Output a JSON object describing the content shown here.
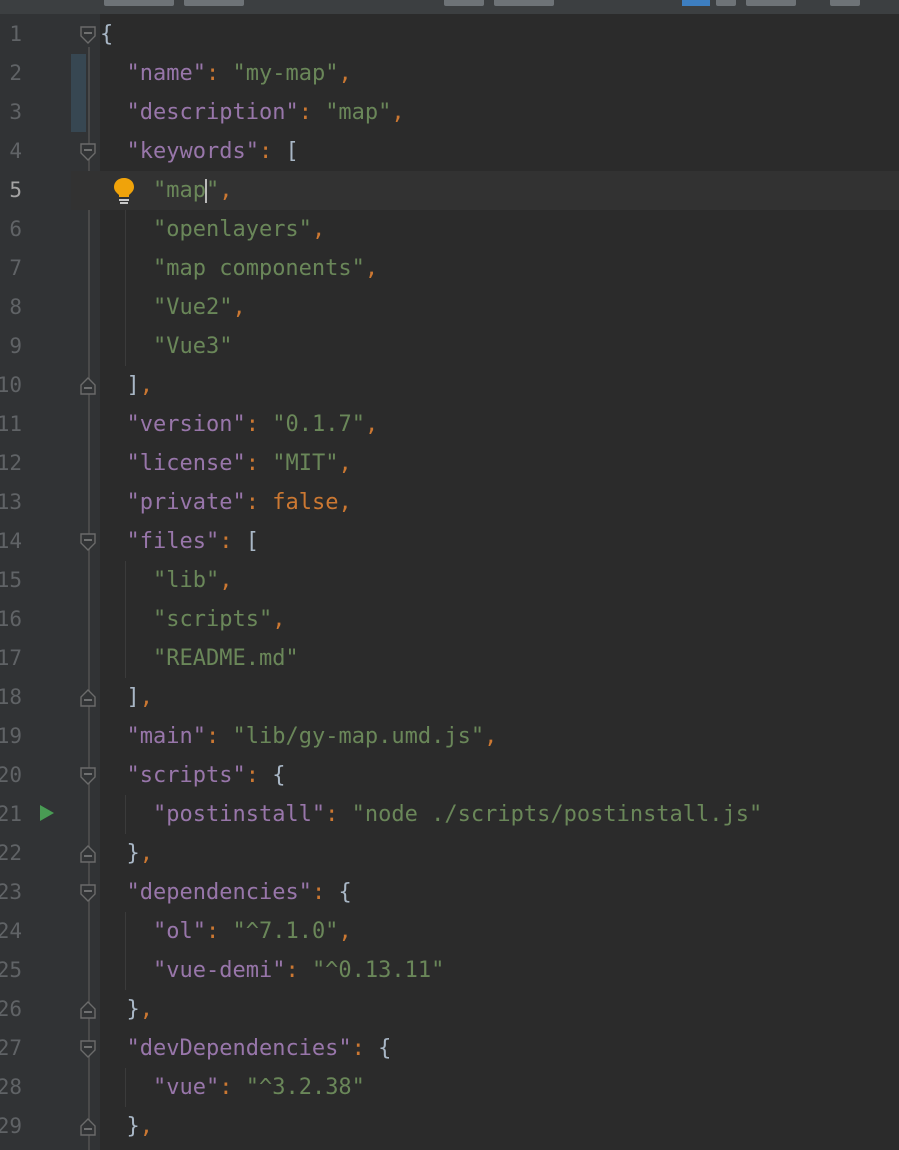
{
  "editor": {
    "file_type": "json",
    "current_line": 5,
    "lines": [
      {
        "num": "1"
      },
      {
        "num": "2"
      },
      {
        "num": "3"
      },
      {
        "num": "4"
      },
      {
        "num": "5"
      },
      {
        "num": "6"
      },
      {
        "num": "7"
      },
      {
        "num": "8"
      },
      {
        "num": "9"
      },
      {
        "num": "10"
      },
      {
        "num": "11"
      },
      {
        "num": "12"
      },
      {
        "num": "13"
      },
      {
        "num": "14"
      },
      {
        "num": "15"
      },
      {
        "num": "16"
      },
      {
        "num": "17"
      },
      {
        "num": "18"
      },
      {
        "num": "19"
      },
      {
        "num": "20"
      },
      {
        "num": "21"
      },
      {
        "num": "22"
      },
      {
        "num": "23"
      },
      {
        "num": "24"
      },
      {
        "num": "25"
      },
      {
        "num": "26"
      },
      {
        "num": "27"
      },
      {
        "num": "28"
      },
      {
        "num": "29"
      }
    ]
  },
  "code": {
    "l1": {
      "brace": "{"
    },
    "l2": {
      "key": "\"name\"",
      "colon": ":",
      "value": "\"my-map\"",
      "comma": ","
    },
    "l3": {
      "key": "\"description\"",
      "colon": ":",
      "value": "\"map\"",
      "comma": ","
    },
    "l4": {
      "key": "\"keywords\"",
      "colon": ":",
      "bracket": "["
    },
    "l5": {
      "value_a": "\"map",
      "value_b": "\"",
      "comma": ","
    },
    "l6": {
      "value": "\"openlayers\"",
      "comma": ","
    },
    "l7": {
      "value": "\"map components\"",
      "comma": ","
    },
    "l8": {
      "value": "\"Vue2\"",
      "comma": ","
    },
    "l9": {
      "value": "\"Vue3\""
    },
    "l10": {
      "bracket": "]",
      "comma": ","
    },
    "l11": {
      "key": "\"version\"",
      "colon": ":",
      "value": "\"0.1.7\"",
      "comma": ","
    },
    "l12": {
      "key": "\"license\"",
      "colon": ":",
      "value": "\"MIT\"",
      "comma": ","
    },
    "l13": {
      "key": "\"private\"",
      "colon": ":",
      "value": "false",
      "comma": ","
    },
    "l14": {
      "key": "\"files\"",
      "colon": ":",
      "bracket": "["
    },
    "l15": {
      "value": "\"lib\"",
      "comma": ","
    },
    "l16": {
      "value": "\"scripts\"",
      "comma": ","
    },
    "l17": {
      "value": "\"README.md\""
    },
    "l18": {
      "bracket": "]",
      "comma": ","
    },
    "l19": {
      "key": "\"main\"",
      "colon": ":",
      "value": "\"lib/gy-map.umd.js\"",
      "comma": ","
    },
    "l20": {
      "key": "\"scripts\"",
      "colon": ":",
      "brace": "{"
    },
    "l21": {
      "key": "\"postinstall\"",
      "colon": ":",
      "value": "\"node ./scripts/postinstall.js\""
    },
    "l22": {
      "brace": "}",
      "comma": ","
    },
    "l23": {
      "key": "\"dependencies\"",
      "colon": ":",
      "brace": "{"
    },
    "l24": {
      "key": "\"ol\"",
      "colon": ":",
      "value": "\"^7.1.0\"",
      "comma": ","
    },
    "l25": {
      "key": "\"vue-demi\"",
      "colon": ":",
      "value": "\"^0.13.11\""
    },
    "l26": {
      "brace": "}",
      "comma": ","
    },
    "l27": {
      "key": "\"devDependencies\"",
      "colon": ":",
      "brace": "{"
    },
    "l28": {
      "key": "\"vue\"",
      "colon": ":",
      "value": "\"^3.2.38\""
    },
    "l29": {
      "brace": "}",
      "comma": ","
    }
  },
  "colors": {
    "background": "#2b2b2b",
    "gutter": "#313335",
    "key": "#9876aa",
    "string": "#6a8759",
    "punctuation": "#cc7832",
    "brace": "#a9b7c6",
    "line_number": "#606366",
    "current_line": "#323232"
  },
  "icons": {
    "intention": "lightbulb-icon",
    "run": "run-triangle-icon",
    "fold_open": "fold-open-icon",
    "fold_close": "fold-close-icon"
  }
}
